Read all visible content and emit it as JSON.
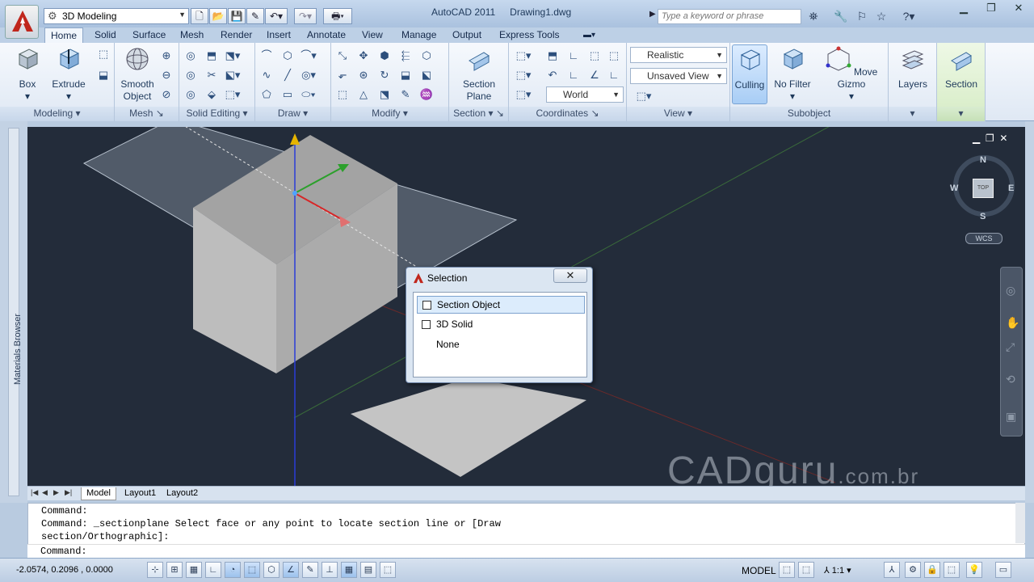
{
  "window": {
    "app_title": "AutoCAD 2011",
    "document": "Drawing1.dwg"
  },
  "workspace": {
    "label": "3D Modeling"
  },
  "search": {
    "placeholder": "Type a keyword or phrase"
  },
  "tabs": [
    "Home",
    "Solid",
    "Surface",
    "Mesh",
    "Render",
    "Insert",
    "Annotate",
    "View",
    "Manage",
    "Output",
    "Express Tools"
  ],
  "ribbon": {
    "modeling": {
      "label": "Modeling",
      "box": "Box",
      "extrude": "Extrude"
    },
    "mesh": {
      "label": "Mesh",
      "smooth": "Smooth Object"
    },
    "solid_editing": {
      "label": "Solid Editing"
    },
    "draw": {
      "label": "Draw"
    },
    "modify": {
      "label": "Modify"
    },
    "section": {
      "label": "Section",
      "plane": "Section Plane"
    },
    "coordinates": {
      "label": "Coordinates",
      "world": "World"
    },
    "view": {
      "label": "View",
      "visual_style": "Realistic",
      "named_view": "Unsaved View"
    },
    "subobject": {
      "label": "Subobject",
      "culling": "Culling",
      "no_filter": "No Filter",
      "move_gizmo": "Move Gizmo"
    },
    "layers": "Layers",
    "section_btn": "Section"
  },
  "sidebar": {
    "materials_browser": "Materials Browser"
  },
  "viewcube": {
    "north": "N",
    "south": "S",
    "east": "E",
    "west": "W",
    "top": "TOP",
    "wcs": "WCS"
  },
  "dialog": {
    "title": "Selection",
    "close": "✕",
    "items": [
      {
        "label": "Section Object",
        "selected": true
      },
      {
        "label": "3D Solid",
        "selected": false
      },
      {
        "label": "None",
        "selected": false
      }
    ]
  },
  "watermark": {
    "main": "CADguru",
    "suffix": ".com.br"
  },
  "layout_tabs": [
    "Model",
    "Layout1",
    "Layout2"
  ],
  "command": {
    "lines": [
      "Command:",
      "Command: _sectionplane Select face or any point to locate section line or [Draw",
      "section/Orthographic]:"
    ],
    "prompt": "Command:"
  },
  "status": {
    "coords": "-2.0574, 0.2096 , 0.0000",
    "model": "MODEL",
    "scale": "1:1"
  }
}
